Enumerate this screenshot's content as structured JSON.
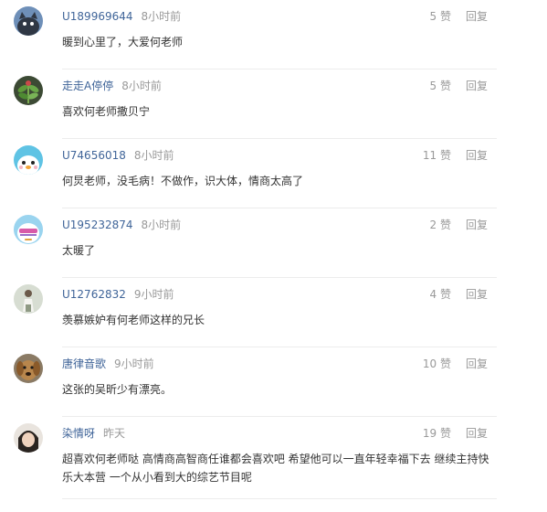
{
  "comments": [
    {
      "user": "U189969644",
      "time": "8小时前",
      "likes": "5 赞",
      "reply": "回复",
      "text": "暖到心里了，大爱何老师",
      "avatar": "cat-avatar-icon"
    },
    {
      "user": "走走A停停",
      "time": "8小时前",
      "likes": "5 赞",
      "reply": "回复",
      "text": "喜欢何老师撒贝宁",
      "avatar": "plant-photo-avatar-icon"
    },
    {
      "user": "U74656018",
      "time": "8小时前",
      "likes": "11 赞",
      "reply": "回复",
      "text": "何炅老师，没毛病！不做作，识大体，情商太高了",
      "avatar": "penguin-avatar-icon"
    },
    {
      "user": "U195232874",
      "time": "8小时前",
      "likes": "2 赞",
      "reply": "回复",
      "text": "太暖了",
      "avatar": "sunglasses-avatar-icon"
    },
    {
      "user": "U12762832",
      "time": "9小时前",
      "likes": "4 赞",
      "reply": "回复",
      "text": "羡慕嫉妒有何老师这样的兄长",
      "avatar": "person-photo-avatar-icon"
    },
    {
      "user": "唐律音歌",
      "time": "9小时前",
      "likes": "10 赞",
      "reply": "回复",
      "text": "这张的吴昕少有漂亮。",
      "avatar": "dog-photo-avatar-icon"
    },
    {
      "user": "染情呀",
      "time": "昨天",
      "likes": "19 赞",
      "reply": "回复",
      "text": "超喜欢何老师哒 高情商高智商任谁都会喜欢吧 希望他可以一直年轻幸福下去 继续主持快乐大本营 一个从小看到大的综艺节目呢",
      "avatar": "girl-photo-avatar-icon"
    }
  ]
}
